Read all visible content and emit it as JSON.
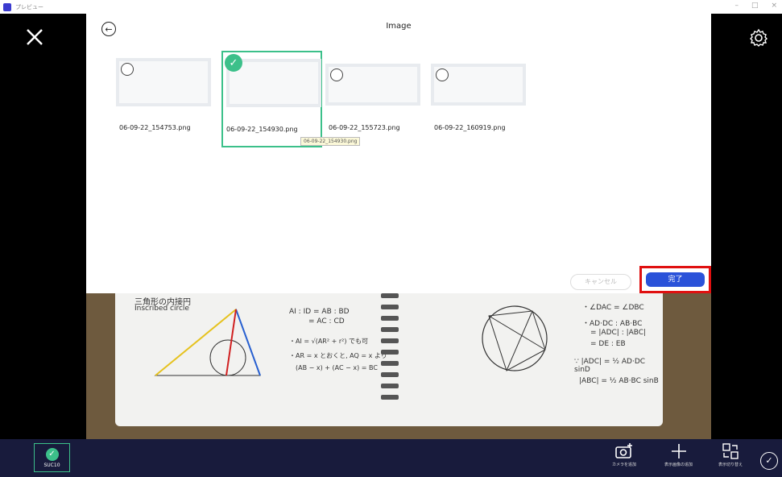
{
  "window": {
    "title": "プレビュー",
    "controls": [
      "–",
      "□",
      "×"
    ]
  },
  "dialog": {
    "title": "Image",
    "thumbnails": [
      {
        "filename": "06-09-22_154753.png",
        "selected": false
      },
      {
        "filename": "06-09-22_154930.png",
        "selected": true
      },
      {
        "filename": "06-09-22_155723.png",
        "selected": false
      },
      {
        "filename": "06-09-22_160919.png",
        "selected": false
      }
    ],
    "tooltip": "06-09-22_154930.png",
    "cancel_label": "キャンセル",
    "done_label": "完了"
  },
  "notebook": {
    "heading_jp": "三角形の内接円",
    "heading_en": "Inscribed circle",
    "left_lines": [
      "AI : ID = AB : BD",
      "= AC : CD",
      "・AI = √(AR² + r²) でも可",
      "・AR = x とおくと, AQ = x より",
      "(AB − x) + (AC − x) = BC"
    ],
    "right_lines": [
      "・∠DAC = ∠DBC",
      "・AD·DC : AB·BC",
      "= |ADC| : |ABC|",
      "= DE : EB",
      "∵ |ADC| = ½ AD·DC sinD",
      "|ABC| = ½ AB·BC sinB"
    ]
  },
  "bottombar": {
    "badge_label": "SUC10",
    "items": [
      {
        "icon": "camera-add-icon",
        "label": "カメラを追加"
      },
      {
        "icon": "plus-icon",
        "label": "表示画像の追加"
      },
      {
        "icon": "switch-icon",
        "label": "表示切り替え"
      }
    ]
  },
  "colors": {
    "accent_green": "#3cc08a",
    "primary_blue": "#2a52d9",
    "highlight_red": "#e01010",
    "bar_bg": "#181b3c"
  }
}
